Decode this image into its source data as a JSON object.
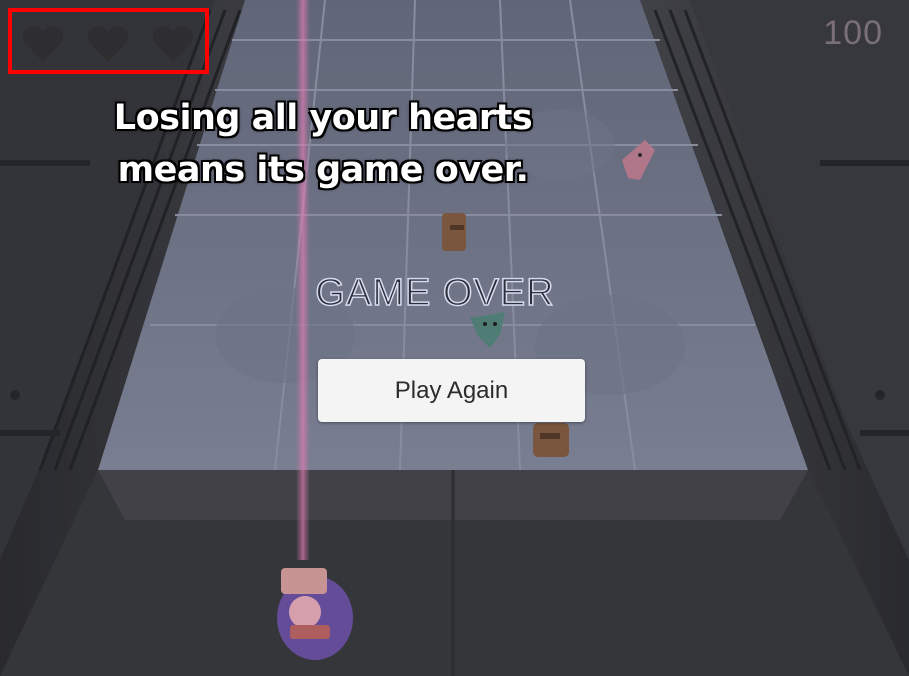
{
  "hud": {
    "hearts": {
      "total": 3,
      "remaining": 0,
      "icon": "heart-icon",
      "highlight_color": "#ff0000"
    },
    "score": "100"
  },
  "tutorial": {
    "line1": "Losing all your hearts",
    "line2": "means its game over."
  },
  "game_over": {
    "title": "GAME OVER",
    "play_again_label": "Play Again"
  }
}
